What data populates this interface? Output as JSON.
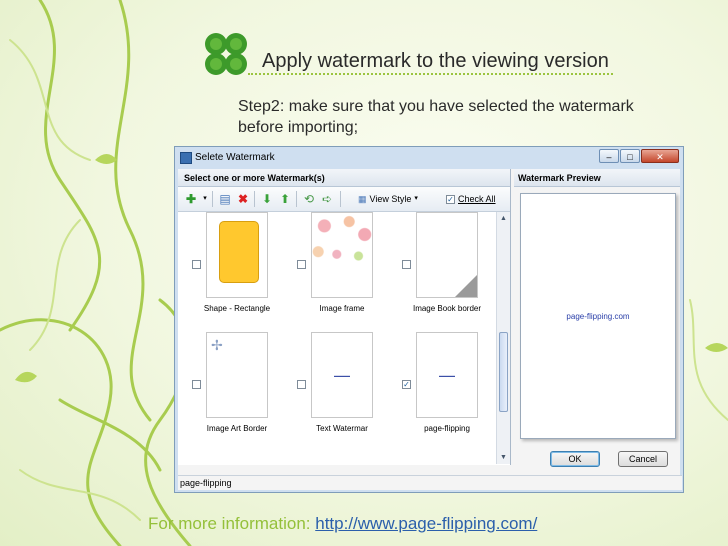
{
  "slide": {
    "title": "Apply watermark to the viewing version",
    "step_text": "Step2: make sure that you have selected the watermark before importing;",
    "footer_label": "For more information: ",
    "footer_url": "http://www.page-flipping.com/"
  },
  "dialog": {
    "title": "Selete Watermark",
    "close_glyph": "✕",
    "minimize_glyph": "–",
    "maximize_glyph": "□",
    "list_header": "Select one or more Watermark(s)",
    "preview_header": "Watermark Preview",
    "preview_text": "page-flipping.com",
    "toolbar": {
      "view_style_label": "View Style",
      "check_all_label": "Check All"
    },
    "items": [
      {
        "label": "Shape - Rectangle",
        "checked": false,
        "thumb_icon": "rectangle-shape"
      },
      {
        "label": "Image frame",
        "checked": false,
        "thumb_icon": "floral-frame"
      },
      {
        "label": "Image Book border",
        "checked": false,
        "thumb_icon": "page-curl"
      },
      {
        "label": "Image Art Border",
        "checked": false,
        "thumb_icon": "dragonfly"
      },
      {
        "label": "Text Watermar",
        "checked": false,
        "thumb_icon": "tiny-text"
      },
      {
        "label": "page-flipping",
        "checked": true,
        "thumb_icon": "tiny-text"
      }
    ],
    "ok_label": "OK",
    "cancel_label": "Cancel",
    "status_text": "page-flipping"
  },
  "colors": {
    "accent_green": "#94c03a",
    "link_blue": "#2b5fab",
    "rect_fill": "#ffc82e"
  }
}
